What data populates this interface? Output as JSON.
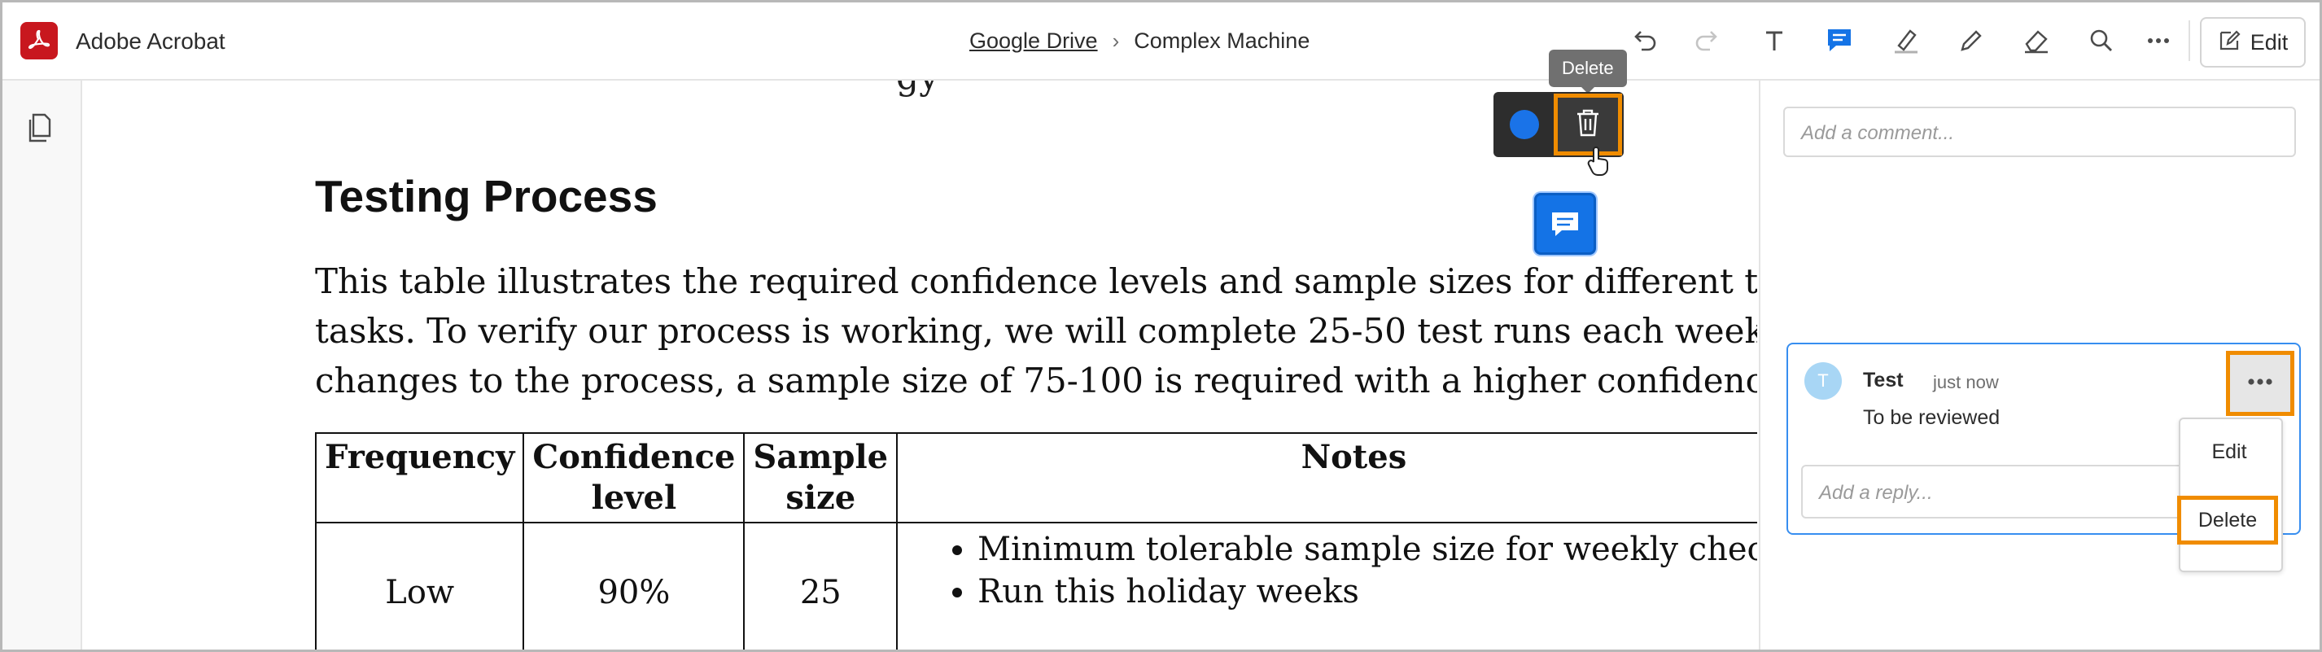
{
  "app": {
    "title": "Adobe Acrobat"
  },
  "breadcrumb": {
    "root": "Google Drive",
    "current": "Complex Machine"
  },
  "toolbar": {
    "edit_label": "Edit"
  },
  "tooltip": {
    "text": "Delete"
  },
  "document": {
    "top_fragment": "gy",
    "heading": "Testing Process",
    "paragraph_lines": [
      "This table illustrates the required confidence levels and sample sizes for different testir",
      "tasks. To verify our process is working, we will complete 25-50 test runs each week. Fo",
      "changes to the process, a sample size of 75-100 is required with a higher confidence lev"
    ],
    "table": {
      "headers": [
        "Frequency",
        "Confidence level",
        "Sample size",
        "Notes"
      ],
      "rows": [
        {
          "frequency": "Low",
          "confidence": "90%",
          "sample_size": "25",
          "notes": [
            "Minimum tolerable sample size for weekly checks",
            "Run this holiday weeks"
          ]
        }
      ]
    }
  },
  "comments_pane": {
    "comment_placeholder": "Add a comment...",
    "comment": {
      "avatar_initial": "T",
      "author": "Test",
      "time": "just now",
      "body": "To be reviewed"
    },
    "reply_placeholder": "Add a reply...",
    "menu": {
      "edit": "Edit",
      "delete": "Delete"
    }
  },
  "colors": {
    "accent": "#1473e6",
    "highlight": "#f08c00",
    "brand": "#c8171e"
  },
  "icons": [
    "undo-icon",
    "redo-icon",
    "text-icon",
    "comment-icon",
    "highlight-icon",
    "pencil-icon",
    "eraser-icon",
    "search-icon",
    "more-icon",
    "edit-icon",
    "pages-icon",
    "trash-icon"
  ]
}
